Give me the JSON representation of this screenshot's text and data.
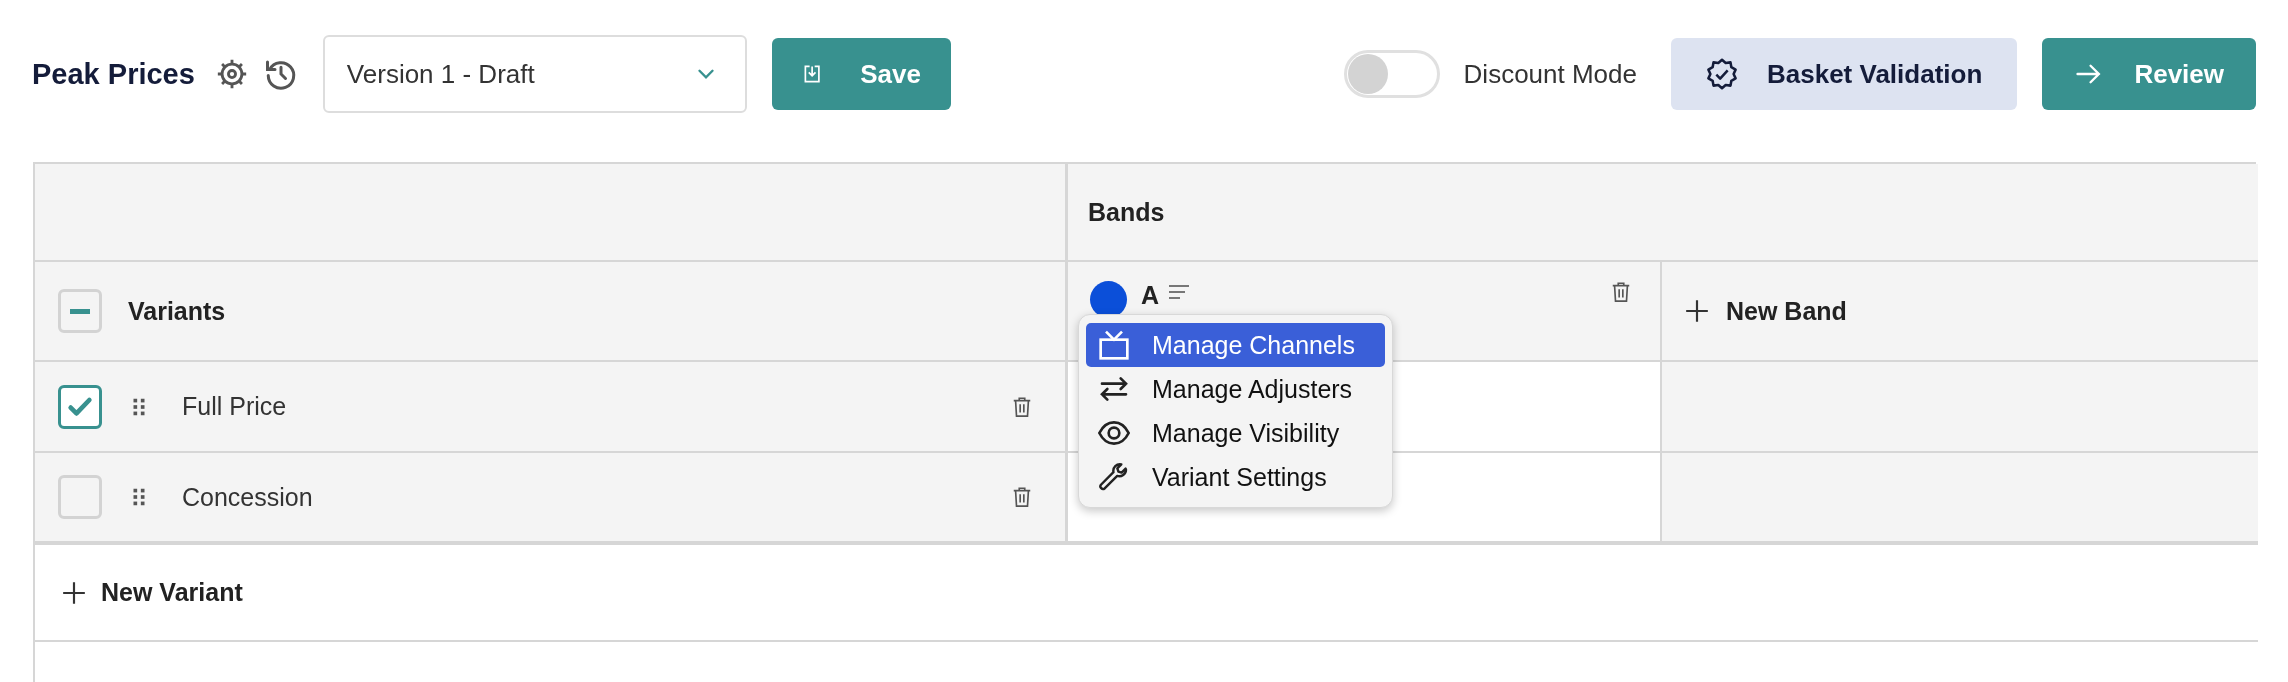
{
  "header": {
    "title": "Peak Prices",
    "version_select": {
      "value": "Version 1 - Draft"
    },
    "save_button": "Save",
    "discount_mode": {
      "label": "Discount Mode",
      "on": false
    },
    "basket_validation_button": "Basket Validation",
    "review_button": "Review"
  },
  "table": {
    "group_header": "Bands",
    "variants_header": {
      "label": "Variants",
      "indeterminate": true
    },
    "bands": [
      {
        "name": "A",
        "color": "#0b4fd9"
      }
    ],
    "new_band": "New Band",
    "variants": [
      {
        "name": "Full Price",
        "checked": true
      },
      {
        "name": "Concession",
        "checked": false
      }
    ],
    "new_variant": "New Variant"
  },
  "context_menu": {
    "items": [
      {
        "kind": "channels",
        "label": "Manage Channels",
        "selected": true
      },
      {
        "kind": "adjusters",
        "label": "Manage Adjusters",
        "selected": false
      },
      {
        "kind": "visibility",
        "label": "Manage Visibility",
        "selected": false
      },
      {
        "kind": "settings",
        "label": "Variant Settings",
        "selected": false
      }
    ]
  }
}
